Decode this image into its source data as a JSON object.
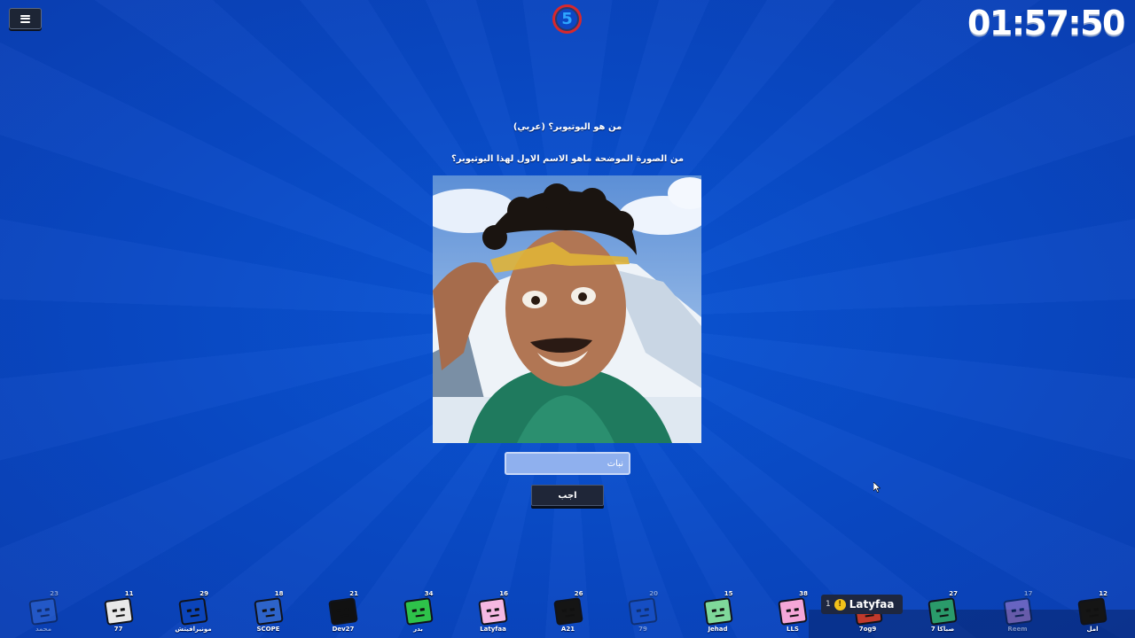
{
  "header": {
    "menu_label": "menu",
    "round_number": "5",
    "timer": "01:57:50"
  },
  "question": {
    "title": "من هو اليوتيوبر؟ (عربي)",
    "text": "من الصورة الموضحة ماهو الاسم الاول لهذا اليوتيوبر؟",
    "image_alt": "youtuber-photo"
  },
  "answer": {
    "placeholder": "نبات",
    "value": "",
    "submit_label": "اجب"
  },
  "leader": {
    "rank": "1",
    "name": "Latyfaa"
  },
  "players": [
    {
      "name": "محمد",
      "score": "23",
      "color": "#3b6fd8"
    },
    {
      "name": "77",
      "score": "11",
      "color": "#e8e8e8"
    },
    {
      "name": "مونيرافيتش",
      "score": "29",
      "color": "#0b44b9"
    },
    {
      "name": "SCOPE",
      "score": "18",
      "color": "#2d63c9"
    },
    {
      "name": "Dev27",
      "score": "21",
      "color": "#111111"
    },
    {
      "name": "بدر",
      "score": "34",
      "color": "#2ec24a"
    },
    {
      "name": "Latyfaa",
      "score": "16",
      "color": "#f5b8e2"
    },
    {
      "name": "A21",
      "score": "26",
      "color": "#151515"
    },
    {
      "name": "79",
      "score": "20",
      "color": "#1f55c5"
    },
    {
      "name": "Jehad",
      "score": "15",
      "color": "#7fd89a"
    },
    {
      "name": "LLS",
      "score": "38",
      "color": "#f4a6d7"
    },
    {
      "name": "7og9",
      "score": "",
      "color": "#c0392b"
    },
    {
      "name": "صباكا 7",
      "score": "27",
      "color": "#2a9a6a"
    },
    {
      "name": "Reem",
      "score": "17",
      "color": "#d98fd0"
    },
    {
      "name": "امل",
      "score": "12",
      "color": "#151515"
    }
  ]
}
